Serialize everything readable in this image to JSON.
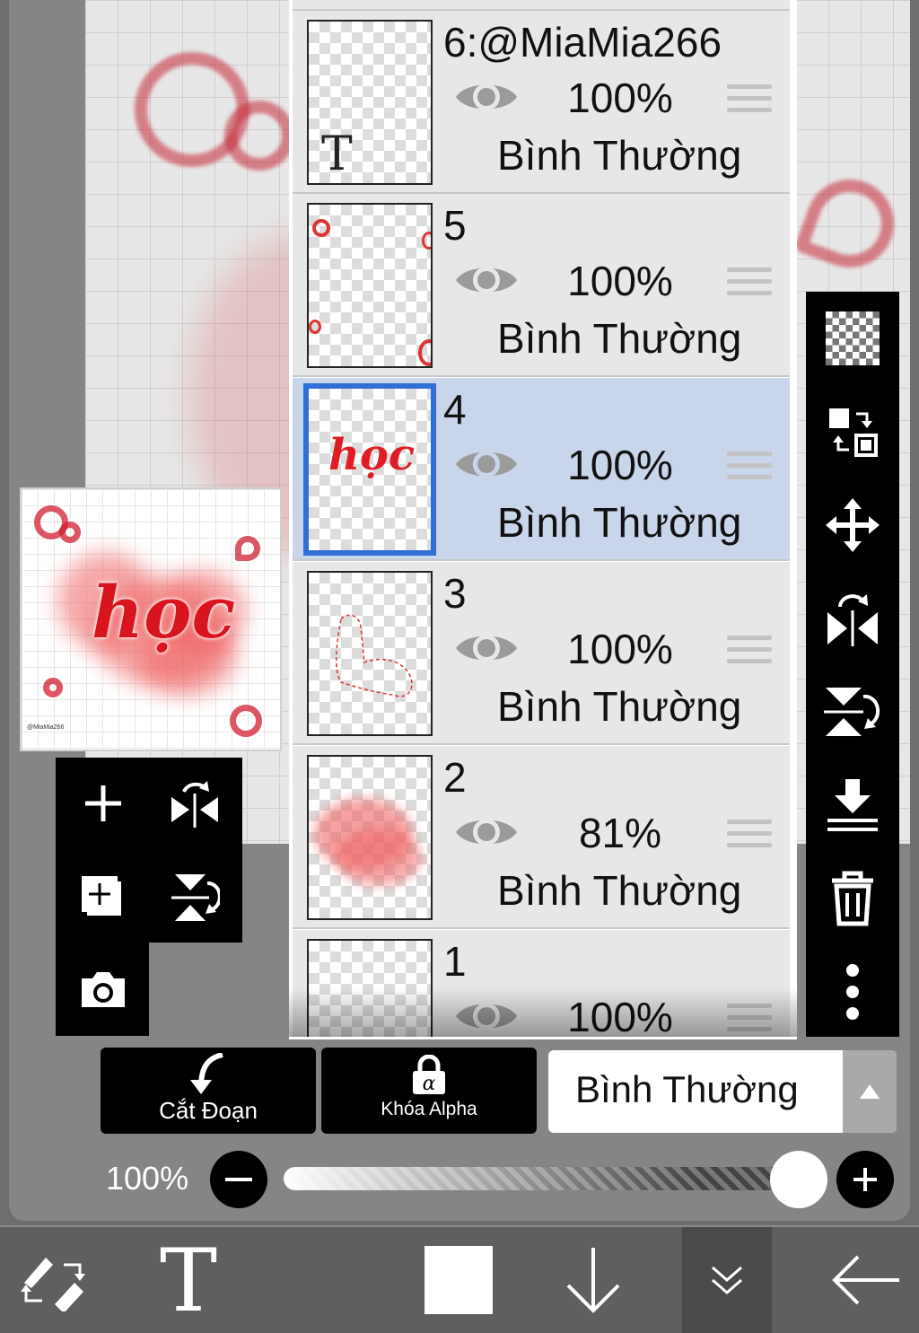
{
  "layers": [
    {
      "name": "6:@MiaMia266",
      "opacity": "100%",
      "blend": "Bình Thường",
      "thumb_glyph": "T"
    },
    {
      "name": "5",
      "opacity": "100%",
      "blend": "Bình Thường"
    },
    {
      "name": "4",
      "opacity": "100%",
      "blend": "Bình Thường",
      "thumb_text": "học"
    },
    {
      "name": "3",
      "opacity": "100%",
      "blend": "Bình Thường"
    },
    {
      "name": "2",
      "opacity": "81%",
      "blend": "Bình Thường"
    },
    {
      "name": "1",
      "opacity": "100%",
      "blend": ""
    }
  ],
  "preview": {
    "word": "học",
    "signature": "@MiaMia266"
  },
  "controls": {
    "clipping_label": "Cắt Đoạn",
    "alpha_lock_label": "Khóa Alpha",
    "blend_mode_value": "Bình Thường",
    "opacity_label": "100%",
    "opacity_value": 1.0
  },
  "icons": {
    "left_panel": [
      "plus-icon",
      "flip-horizontal-icon",
      "add-layer-icon",
      "flip-vertical-icon",
      "camera-icon"
    ],
    "right_panel": [
      "checker-icon",
      "swap-layers-icon",
      "move-icon",
      "flip-horizontal-icon",
      "flip-vertical-icon",
      "merge-down-icon",
      "trash-icon",
      "more-icon"
    ],
    "bottom_bar": [
      "brush-eraser-swap-icon",
      "text-tool-icon",
      "color-swatch-icon",
      "download-arrow-icon",
      "collapse-icon",
      "back-arrow-icon"
    ]
  },
  "colors": {
    "selected_layer": "#c9d5ea",
    "selection_border": "#2f6fd6",
    "primary_color": "#ffffff",
    "accent_red": "#d8141f"
  }
}
